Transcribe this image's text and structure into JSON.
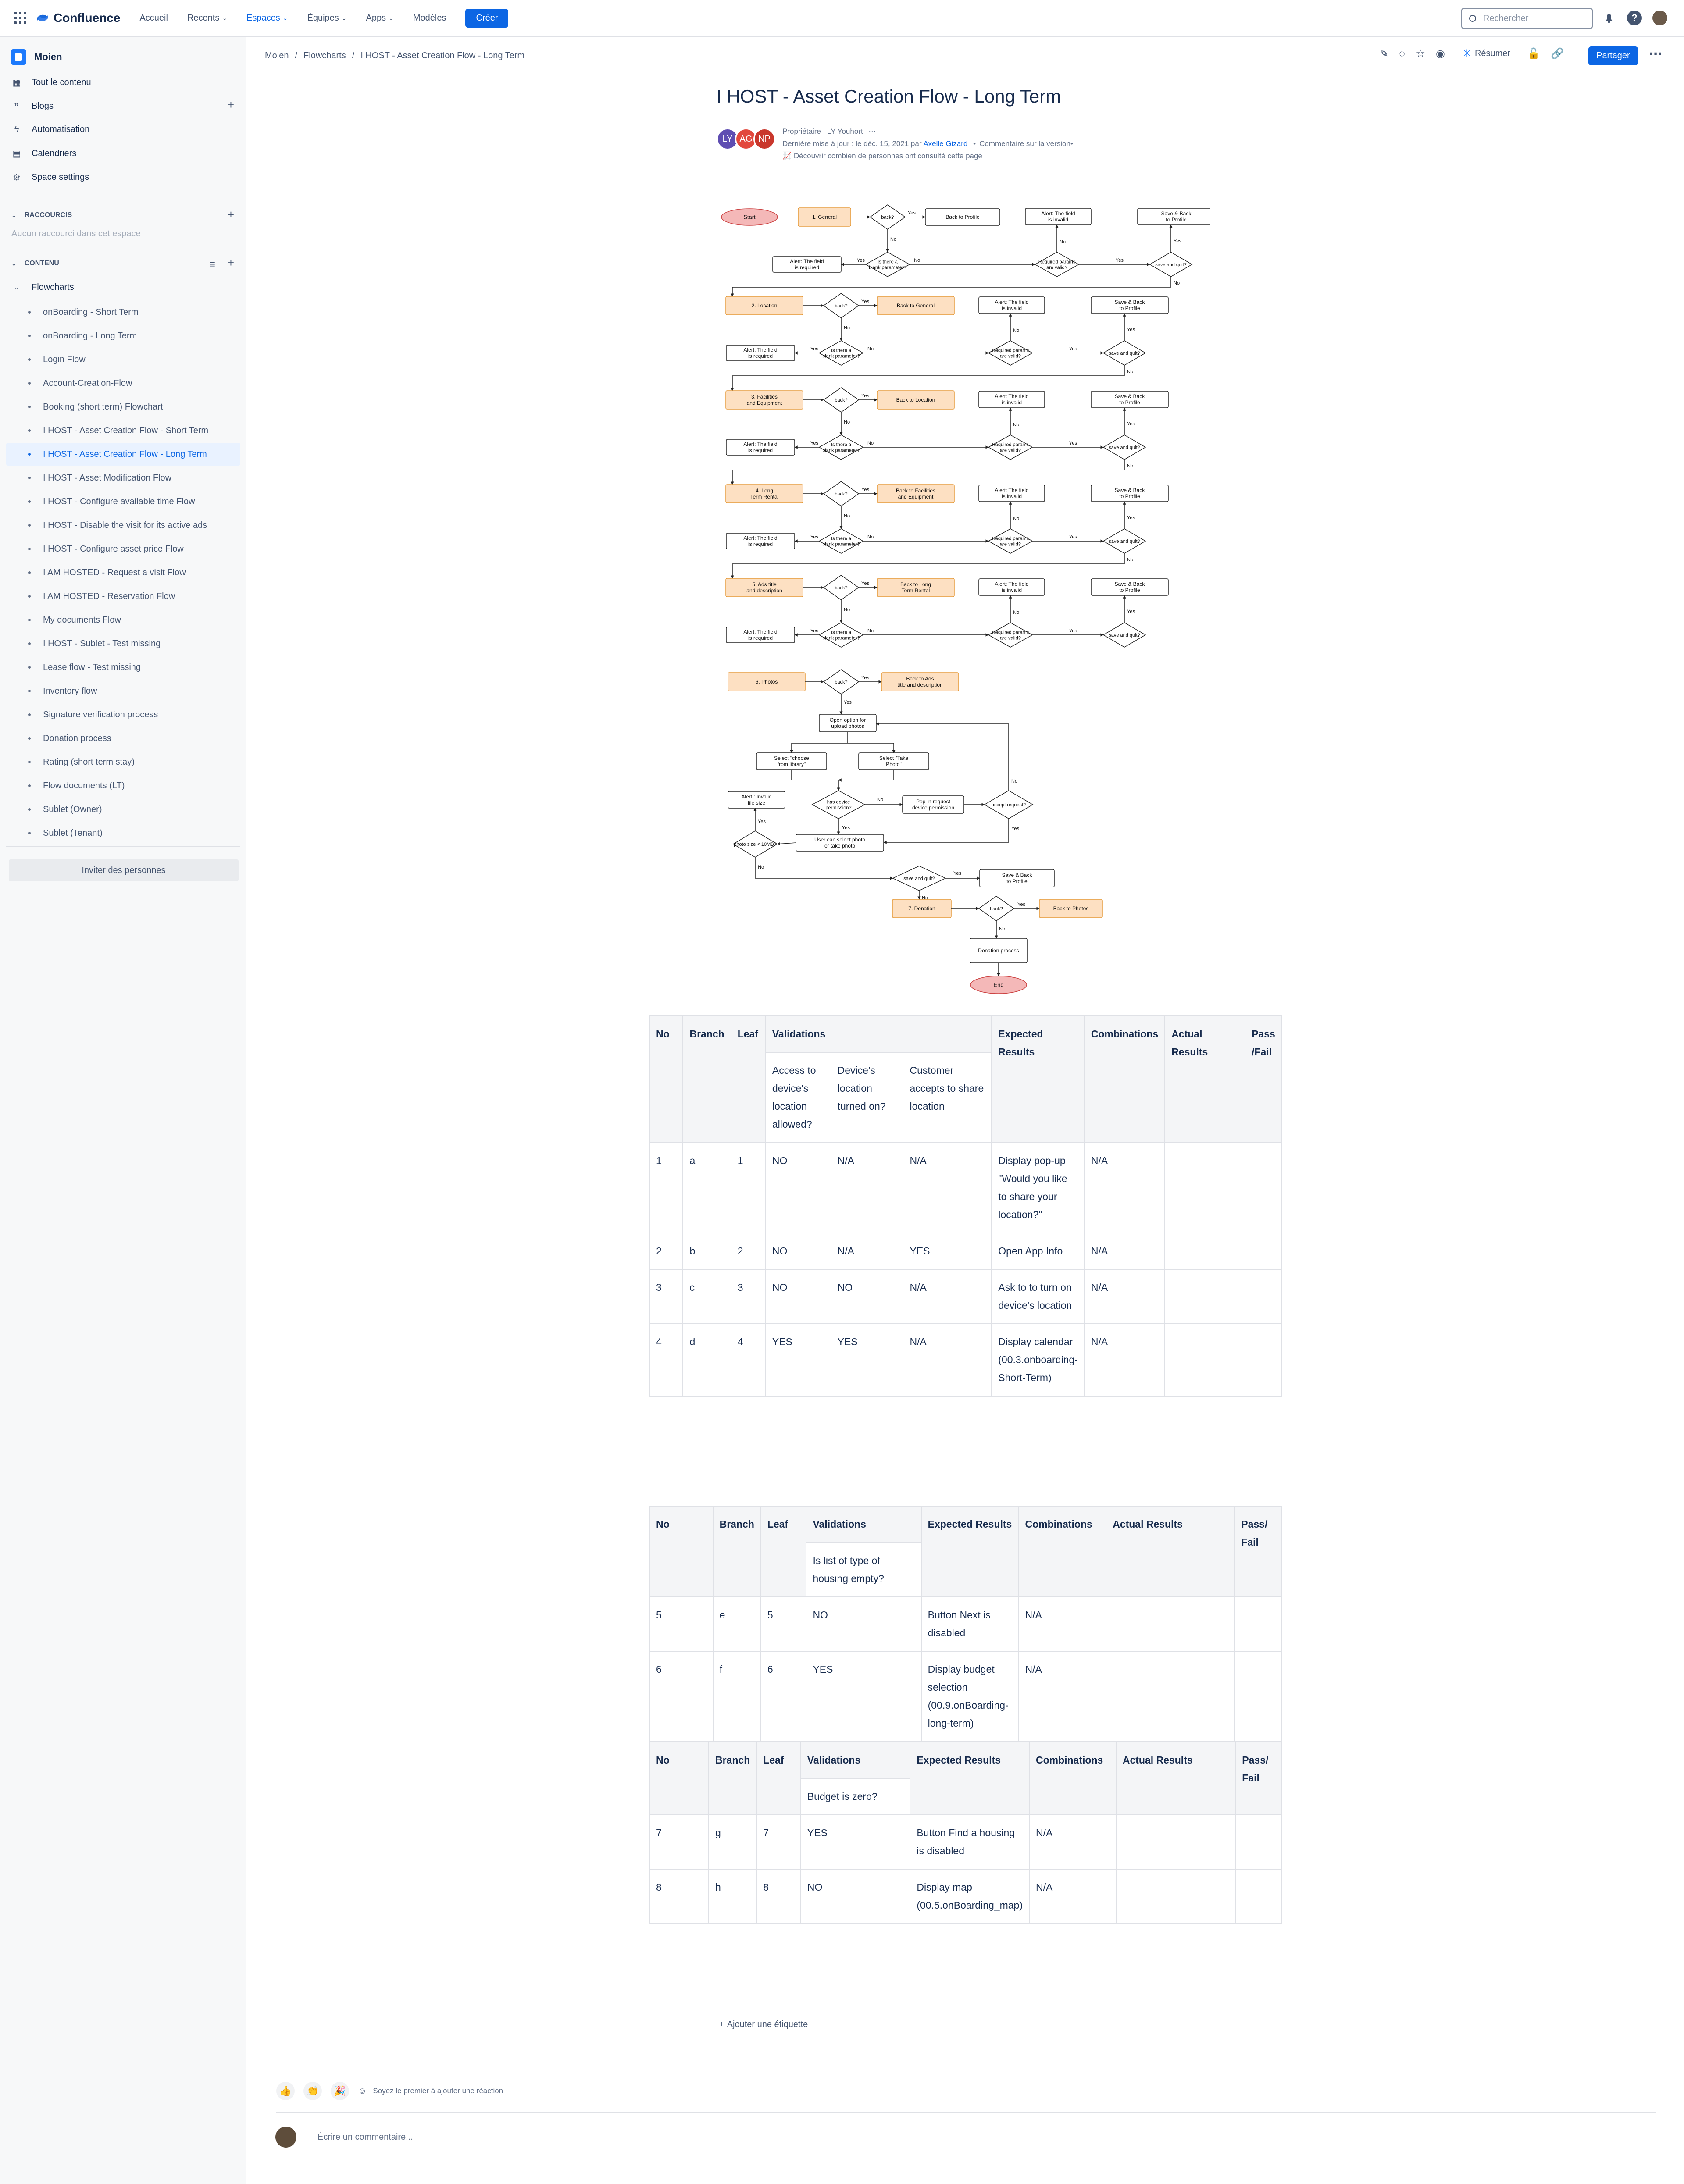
{
  "topnav": {
    "brand": "Confluence",
    "items": [
      "Accueil",
      "Recents",
      "Espaces",
      "Équipes",
      "Apps",
      "Modèles"
    ],
    "create_label": "Créer",
    "search_placeholder": "Rechercher"
  },
  "sidebar": {
    "space_name": "Moien",
    "links": [
      "Tout le contenu",
      "Blogs",
      "Automatisation",
      "Calendriers",
      "Space settings"
    ],
    "shortcuts_header": "RACCOURCIS",
    "shortcuts_empty": "Aucun raccourci dans cet espace",
    "content_header": "CONTENU",
    "tree_root": "Flowcharts",
    "tree_items": [
      "onBoarding - Short Term",
      "onBoarding - Long Term",
      "Login Flow",
      "Account-Creation-Flow",
      "Booking (short term) Flowchart",
      "I HOST - Asset Creation Flow - Short Term",
      "I HOST - Asset Creation Flow - Long Term",
      "I HOST - Asset Modification Flow",
      "I HOST - Configure available time Flow",
      "I HOST - Disable the visit for its active ads",
      "I HOST - Configure asset price Flow",
      "I AM HOSTED - Request a visit Flow",
      "I AM HOSTED - Reservation Flow",
      "My documents Flow",
      "I HOST - Sublet - Test missing",
      "Lease flow - Test missing",
      "Inventory flow",
      "Signature verification process",
      "Donation process",
      "Rating (short term stay)",
      "Flow documents (LT)",
      "Sublet (Owner)",
      "Sublet (Tenant)"
    ],
    "active_index": 6,
    "invite_label": "Inviter des personnes"
  },
  "breadcrumb": [
    "Moien",
    "Flowcharts",
    "I HOST - Asset Creation Flow - Long Term"
  ],
  "actions": {
    "summarize": "Résumer",
    "share": "Partager"
  },
  "page": {
    "title": "I HOST - Asset Creation Flow - Long Term",
    "avatars": [
      {
        "initials": "LY",
        "color": "#5e4db2"
      },
      {
        "initials": "AG",
        "color": "#e2483d"
      },
      {
        "initials": "NP",
        "color": "#c9372c"
      }
    ],
    "owner_line": "Propriétaire : LY Youhort",
    "updated_prefix": "Dernière mise à jour : le déc. 15, 2021 par",
    "updated_by": "Axelle Gizard",
    "version_comment": "Commentaire sur la version",
    "analytics": "Découvrir combien de personnes ont consulté cette page"
  },
  "flowchart": {
    "start": "Start",
    "end": "End",
    "steps": [
      "1. General",
      "2. Location",
      "3. Facilities and Equipment",
      "4. Long Term Rental",
      "5. Ads title and description",
      "6. Photos",
      "7. Donation"
    ],
    "backs": [
      "Back to Profile",
      "Back to General",
      "Back to Location",
      "Back to Facilities and Equipment",
      "Back to Long Term Rental",
      "Back to Ads title and description",
      "Back to Photos"
    ],
    "back_q": "back?",
    "blank_q": "Is there a blank parameter?",
    "valid_q": "Required params are valid?",
    "save_q": "save and quit?",
    "alert_required": "Alert: The field is required",
    "alert_invalid": "Alert: The field is invalid",
    "save_back": "Save & Back to Profile",
    "yes": "Yes",
    "no": "No",
    "photo": {
      "open": "Open option for upload photos",
      "library": "Select \"choose from library\"",
      "take": "Select \"Take Photo\"",
      "device_perm": "has device permission?",
      "popin": "Pop-in request device permission",
      "accept": "accept request?",
      "user_select": "User can select photo or take photo",
      "size": "photo size < 10MB?",
      "invalid_size": "Alert : Invalid file size",
      "donation_process": "Donation process"
    }
  },
  "table1": {
    "headers": [
      "No",
      "Branch",
      "Leaf",
      "Validations",
      "Expected Results",
      "Combinations",
      "Actual Results",
      "Pass /Fail"
    ],
    "subheaders": [
      "Access to device's location allowed?",
      "Device's location turned on?",
      "Customer accepts to share location"
    ],
    "rows": [
      [
        "1",
        "a",
        "1",
        "NO",
        "N/A",
        "N/A",
        "Display pop-up \"Would you like to share your location?\"",
        "N/A",
        "",
        ""
      ],
      [
        "2",
        "b",
        "2",
        "NO",
        "N/A",
        "YES",
        "Open App Info",
        "N/A",
        "",
        ""
      ],
      [
        "3",
        "c",
        "3",
        "NO",
        "NO",
        "N/A",
        "Ask to to turn on device's location",
        "N/A",
        "",
        ""
      ],
      [
        "4",
        "d",
        "4",
        "YES",
        "YES",
        "N/A",
        "Display calendar (00.3.onboarding-Short-Term)",
        "N/A",
        "",
        ""
      ]
    ]
  },
  "table2": {
    "headers": [
      "No",
      "Branch",
      "Leaf",
      "Validations",
      "Expected Results",
      "Combinations",
      "Actual Results",
      "Pass/ Fail"
    ],
    "subheader": "Is list of type of housing empty?",
    "rows": [
      [
        "5",
        "e",
        "5",
        "NO",
        "Button Next is disabled",
        "N/A",
        "",
        ""
      ],
      [
        "6",
        "f",
        "6",
        "YES",
        "Display budget selection (00.9.onBoarding-long-term)",
        "N/A",
        "",
        ""
      ]
    ]
  },
  "table3": {
    "headers": [
      "No",
      "Branch",
      "Leaf",
      "Validations",
      "Expected Results",
      "Combinations",
      "Actual Results",
      "Pass/ Fail"
    ],
    "subheader": "Budget is zero?",
    "rows": [
      [
        "7",
        "g",
        "7",
        "YES",
        "Button Find a housing is disabled",
        "N/A",
        "",
        ""
      ],
      [
        "8",
        "h",
        "8",
        "NO",
        "Display map (00.5.onBoarding_map)",
        "N/A",
        "",
        ""
      ]
    ]
  },
  "footer": {
    "add_label": "Ajouter une étiquette",
    "reaction_prompt": "Soyez le premier à ajouter une réaction",
    "comment_placeholder": "Écrire un commentaire..."
  }
}
